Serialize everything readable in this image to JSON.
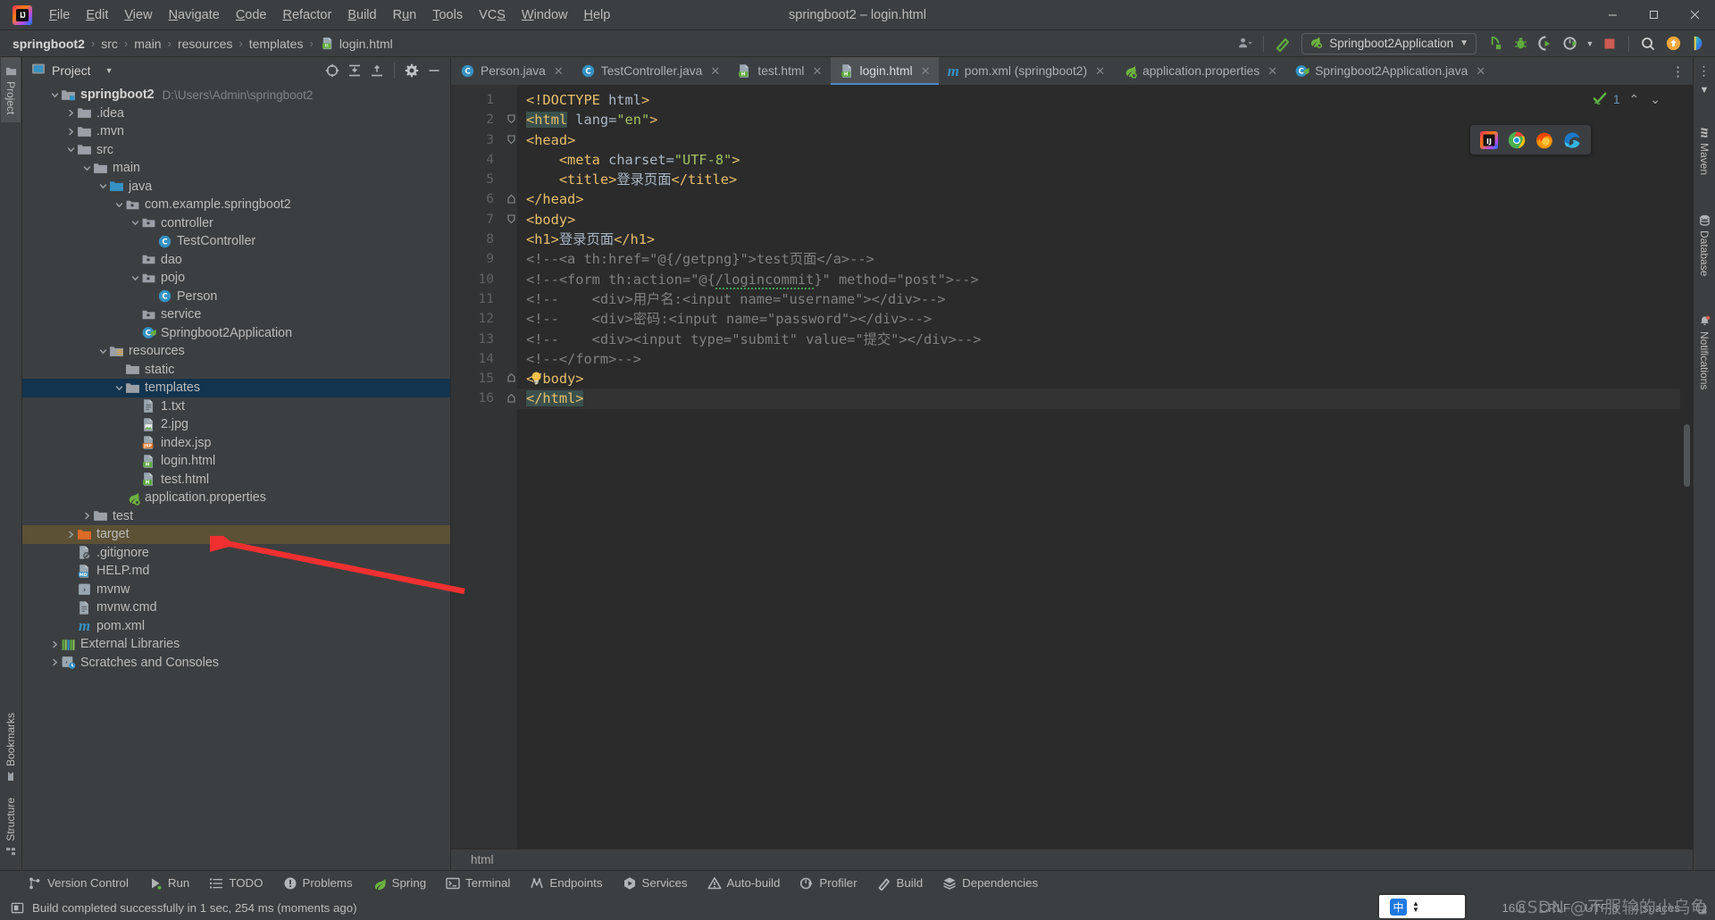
{
  "window": {
    "title": "springboot2 – login.html",
    "minimize_label": "—",
    "maximize_label": "❐",
    "close_label": "✕"
  },
  "menubar": [
    {
      "label": "File",
      "mnemonic": "F"
    },
    {
      "label": "Edit",
      "mnemonic": "E"
    },
    {
      "label": "View",
      "mnemonic": "V"
    },
    {
      "label": "Navigate",
      "mnemonic": "N"
    },
    {
      "label": "Code",
      "mnemonic": "C"
    },
    {
      "label": "Refactor",
      "mnemonic": "R"
    },
    {
      "label": "Build",
      "mnemonic": "B"
    },
    {
      "label": "Run",
      "mnemonic": "u"
    },
    {
      "label": "Tools",
      "mnemonic": "T"
    },
    {
      "label": "VCS",
      "mnemonic": "S"
    },
    {
      "label": "Window",
      "mnemonic": "W"
    },
    {
      "label": "Help",
      "mnemonic": "H"
    }
  ],
  "breadcrumb": {
    "items": [
      "springboot2",
      "src",
      "main",
      "resources",
      "templates",
      "login.html"
    ],
    "separator": "›"
  },
  "toolbar": {
    "run_config_label": "Springboot2Application",
    "dropdown_caret": "▾",
    "icons": [
      "account-icon",
      "hammer-build-icon",
      "run-icon",
      "debug-icon",
      "run-with-coverage-icon",
      "profiler-icon",
      "stop-icon",
      "search-everywhere-icon",
      "updates-icon",
      "ide-feature-icon"
    ]
  },
  "left_strip": {
    "top": [
      {
        "label": "Project",
        "icon": "project-folder-icon",
        "active": true
      }
    ],
    "bottom": [
      {
        "label": "Bookmarks",
        "icon": "bookmark-icon"
      },
      {
        "label": "Structure",
        "icon": "structure-icon"
      }
    ]
  },
  "right_strip": [
    {
      "label": "Maven",
      "icon": "maven-m-icon"
    },
    {
      "label": "Database",
      "icon": "database-icon"
    },
    {
      "label": "Notifications",
      "icon": "bell-icon"
    }
  ],
  "project_panel": {
    "title": "Project",
    "title_caret": "▾",
    "toolbar_icons": [
      "select-opened-file-icon",
      "expand-all-icon",
      "collapse-all-icon",
      "settings-gear-icon",
      "hide-icon"
    ],
    "tree": [
      {
        "label": "springboot2",
        "path": "D:\\Users\\Admin\\springboot2",
        "depth": 0,
        "arrow": "down",
        "icon": "module-folder-icon",
        "bold": true
      },
      {
        "label": ".idea",
        "depth": 1,
        "arrow": "right",
        "icon": "folder-icon"
      },
      {
        "label": ".mvn",
        "depth": 1,
        "arrow": "right",
        "icon": "folder-icon"
      },
      {
        "label": "src",
        "depth": 1,
        "arrow": "down",
        "icon": "folder-icon"
      },
      {
        "label": "main",
        "depth": 2,
        "arrow": "down",
        "icon": "folder-icon"
      },
      {
        "label": "java",
        "depth": 3,
        "arrow": "down",
        "icon": "source-root-folder-icon"
      },
      {
        "label": "com.example.springboot2",
        "depth": 4,
        "arrow": "down",
        "icon": "package-icon"
      },
      {
        "label": "controller",
        "depth": 5,
        "arrow": "down",
        "icon": "package-icon"
      },
      {
        "label": "TestController",
        "depth": 6,
        "arrow": "none",
        "icon": "java-class-icon"
      },
      {
        "label": "dao",
        "depth": 5,
        "arrow": "none",
        "icon": "package-icon"
      },
      {
        "label": "pojo",
        "depth": 5,
        "arrow": "down",
        "icon": "package-icon"
      },
      {
        "label": "Person",
        "depth": 6,
        "arrow": "none",
        "icon": "java-class-icon"
      },
      {
        "label": "service",
        "depth": 5,
        "arrow": "none",
        "icon": "package-icon"
      },
      {
        "label": "Springboot2Application",
        "depth": 5,
        "arrow": "none",
        "icon": "spring-boot-class-icon"
      },
      {
        "label": "resources",
        "depth": 3,
        "arrow": "down",
        "icon": "resources-root-folder-icon"
      },
      {
        "label": "static",
        "depth": 4,
        "arrow": "none",
        "icon": "folder-icon"
      },
      {
        "label": "templates",
        "depth": 4,
        "arrow": "down",
        "icon": "folder-icon",
        "selected": true
      },
      {
        "label": "1.txt",
        "depth": 5,
        "arrow": "none",
        "icon": "text-file-icon"
      },
      {
        "label": "2.jpg",
        "depth": 5,
        "arrow": "none",
        "icon": "image-file-icon"
      },
      {
        "label": "index.jsp",
        "depth": 5,
        "arrow": "none",
        "icon": "jsp-file-icon"
      },
      {
        "label": "login.html",
        "depth": 5,
        "arrow": "none",
        "icon": "html-file-icon"
      },
      {
        "label": "test.html",
        "depth": 5,
        "arrow": "none",
        "icon": "html-file-icon"
      },
      {
        "label": "application.properties",
        "depth": 4,
        "arrow": "none",
        "icon": "spring-properties-icon"
      },
      {
        "label": "test",
        "depth": 2,
        "arrow": "right",
        "icon": "folder-icon"
      },
      {
        "label": "target",
        "depth": 1,
        "arrow": "right",
        "icon": "excluded-folder-icon",
        "amber": true
      },
      {
        "label": ".gitignore",
        "depth": 1,
        "arrow": "none",
        "icon": "gitignore-file-icon"
      },
      {
        "label": "HELP.md",
        "depth": 1,
        "arrow": "none",
        "icon": "markdown-file-icon"
      },
      {
        "label": "mvnw",
        "depth": 1,
        "arrow": "none",
        "icon": "shell-script-icon"
      },
      {
        "label": "mvnw.cmd",
        "depth": 1,
        "arrow": "none",
        "icon": "text-file-icon"
      },
      {
        "label": "pom.xml",
        "depth": 1,
        "arrow": "none",
        "icon": "maven-m-icon"
      },
      {
        "label": "External Libraries",
        "depth": 0,
        "arrow": "right",
        "icon": "libraries-icon"
      },
      {
        "label": "Scratches and Consoles",
        "depth": 0,
        "arrow": "right",
        "icon": "scratches-icon"
      }
    ]
  },
  "editor_tabs": [
    {
      "label": "Person.java",
      "icon": "java-class-icon",
      "active": false
    },
    {
      "label": "TestController.java",
      "icon": "java-class-icon",
      "active": false
    },
    {
      "label": "test.html",
      "icon": "html-file-icon",
      "active": false
    },
    {
      "label": "login.html",
      "icon": "html-file-icon",
      "active": true
    },
    {
      "label": "pom.xml (springboot2)",
      "icon": "maven-m-icon",
      "active": false
    },
    {
      "label": "application.properties",
      "icon": "spring-properties-icon",
      "active": false
    },
    {
      "label": "Springboot2Application.java",
      "icon": "spring-boot-class-icon",
      "active": false
    }
  ],
  "editor_tabs_overflow_icon": "more-tabs-icon",
  "inspection_widget": {
    "status_icon": "inspections-ok-icon",
    "count": "1",
    "prev_icon": "⌃",
    "next_icon": "⌄"
  },
  "floating_browsers": [
    {
      "name": "intellij-idea-icon"
    },
    {
      "name": "chrome-icon"
    },
    {
      "name": "firefox-icon"
    },
    {
      "name": "edge-icon"
    }
  ],
  "code": {
    "language_breadcrumb": "html",
    "lines": [
      {
        "n": "1",
        "fold": "",
        "text": "<!DOCTYPE html>"
      },
      {
        "n": "2",
        "fold": "open",
        "text": "<html lang=\"en\">"
      },
      {
        "n": "3",
        "fold": "open",
        "text": "<head>"
      },
      {
        "n": "4",
        "fold": "",
        "text": "    <meta charset=\"UTF-8\">"
      },
      {
        "n": "5",
        "fold": "",
        "text": "    <title>登录页面</title>"
      },
      {
        "n": "6",
        "fold": "close",
        "text": "</head>"
      },
      {
        "n": "7",
        "fold": "open",
        "text": "<body>"
      },
      {
        "n": "8",
        "fold": "",
        "text": "<h1>登录页面</h1>"
      },
      {
        "n": "9",
        "fold": "",
        "text": "<!--<a th:href=\"@{/getpng}\">test页面</a>-->"
      },
      {
        "n": "10",
        "fold": "",
        "text": "<!--<form th:action=\"@{/logincommit}\" method=\"post\">-->"
      },
      {
        "n": "11",
        "fold": "",
        "text": "<!--    <div>用户名:<input name=\"username\"></div>-->"
      },
      {
        "n": "12",
        "fold": "",
        "text": "<!--    <div>密码:<input name=\"password\"></div>-->"
      },
      {
        "n": "13",
        "fold": "",
        "text": "<!--    <div><input type=\"submit\" value=\"提交\"></div>-->"
      },
      {
        "n": "14",
        "fold": "",
        "text": "<!--</form>-->"
      },
      {
        "n": "15",
        "fold": "close",
        "text": "</body>"
      },
      {
        "n": "16",
        "fold": "close",
        "text": "</html>"
      }
    ]
  },
  "bottom_tool_windows": [
    {
      "label": "Version Control",
      "icon": "version-control-icon"
    },
    {
      "label": "Run",
      "icon": "run-icon"
    },
    {
      "label": "TODO",
      "icon": "todo-icon"
    },
    {
      "label": "Problems",
      "icon": "problems-icon"
    },
    {
      "label": "Spring",
      "icon": "spring-leaf-icon"
    },
    {
      "label": "Terminal",
      "icon": "terminal-icon"
    },
    {
      "label": "Endpoints",
      "icon": "endpoints-icon"
    },
    {
      "label": "Services",
      "icon": "services-icon"
    },
    {
      "label": "Auto-build",
      "icon": "auto-build-icon"
    },
    {
      "label": "Profiler",
      "icon": "profiler-icon"
    },
    {
      "label": "Build",
      "icon": "hammer-build-icon"
    },
    {
      "label": "Dependencies",
      "icon": "dependencies-icon"
    }
  ],
  "status_bar": {
    "message_icon": "build-status-icon",
    "message": "Build completed successfully in 1 sec, 254 ms (moments ago)",
    "caret_position": "16:8",
    "line_separator": "CRLF",
    "encoding": "UTF-8",
    "indent": "4 spaces",
    "inspection_icon": "inspections-widget-icon"
  },
  "ime_popup": {
    "badge": "中",
    "caret_up": "▲",
    "caret_down": "▼"
  },
  "watermark": "CSDN @不服输的小乌龟",
  "annotation": {
    "type": "red-arrow",
    "points_to": "login.html",
    "color": "#f03030"
  },
  "colors": {
    "accent": "#4a88c7",
    "selection": "#12344f",
    "excluded": "#5c5135",
    "editor_bg": "#2b2b2b",
    "panel_bg": "#3c3f41",
    "tag": "#e8bf6a",
    "string": "#a5c261",
    "comment": "#808080",
    "text": "#a9b7c6"
  }
}
